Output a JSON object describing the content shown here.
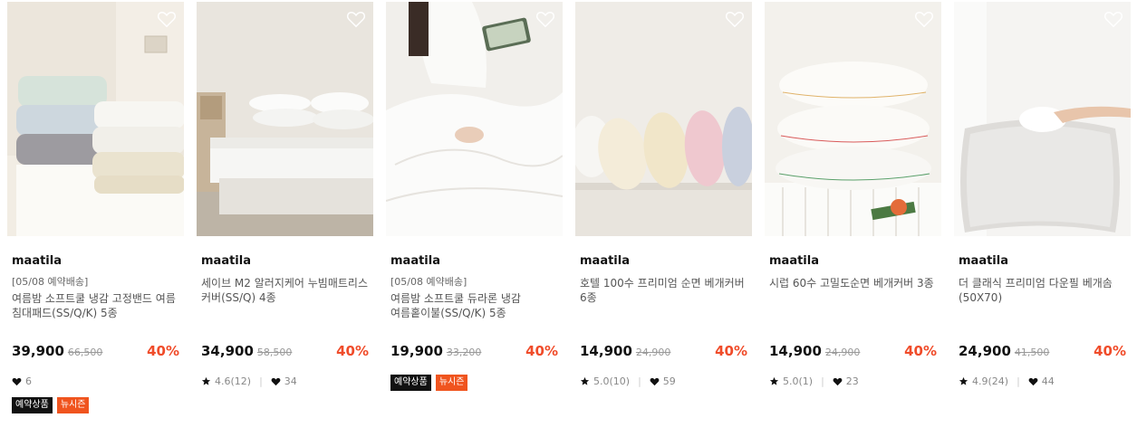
{
  "products": [
    {
      "brand": "maatila",
      "tagline": "[05/08 예약배송]",
      "name": "여름밤 소프트쿨 냉감 고정밴드 여름 침대패드(SS/Q/K) 5종",
      "price": "39,900",
      "original_price": "66,500",
      "discount": "40%",
      "rating": "",
      "likes": "6",
      "badges": [
        "예약상품",
        "뉴시즌"
      ]
    },
    {
      "brand": "maatila",
      "tagline": "",
      "name": "세이브 M2 알러지케어 누빔매트리스 커버(SS/Q) 4종",
      "price": "34,900",
      "original_price": "58,500",
      "discount": "40%",
      "rating": "4.6(12)",
      "likes": "34",
      "badges": []
    },
    {
      "brand": "maatila",
      "tagline": "[05/08 예약배송]",
      "name": "여름밤 소프트쿨 듀라론 냉감 여름홑이불(SS/Q/K) 5종",
      "price": "19,900",
      "original_price": "33,200",
      "discount": "40%",
      "rating": "",
      "likes": "",
      "badges": [
        "예약상품",
        "뉴시즌"
      ]
    },
    {
      "brand": "maatila",
      "tagline": "",
      "name": "호텔 100수 프리미엄 순면 베개커버 6종",
      "price": "14,900",
      "original_price": "24,900",
      "discount": "40%",
      "rating": "5.0(10)",
      "likes": "59",
      "badges": []
    },
    {
      "brand": "maatila",
      "tagline": "",
      "name": "시럽 60수 고밀도순면 베개커버 3종",
      "price": "14,900",
      "original_price": "24,900",
      "discount": "40%",
      "rating": "5.0(1)",
      "likes": "23",
      "badges": []
    },
    {
      "brand": "maatila",
      "tagline": "",
      "name": "더 클래식 프리미엄 다운필 베개솜(50X70)",
      "price": "24,900",
      "original_price": "41,500",
      "discount": "40%",
      "rating": "4.9(24)",
      "likes": "44",
      "badges": []
    }
  ],
  "colors": {
    "discount": "#f04c2a",
    "badge_dark": "#111111",
    "badge_orange": "#f0541e"
  },
  "icons": {
    "wishlist": "heart-outline-icon",
    "rating": "star-icon",
    "likes": "heart-icon"
  }
}
